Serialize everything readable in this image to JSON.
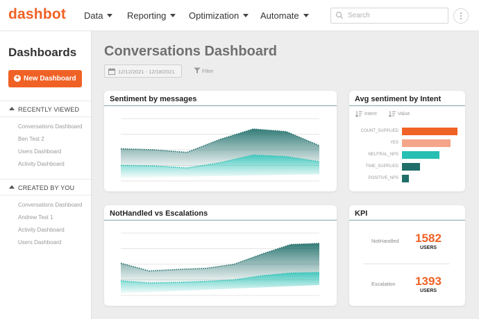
{
  "app": {
    "logo": "dashbot"
  },
  "nav": {
    "items": [
      {
        "label": "Data"
      },
      {
        "label": "Reporting"
      },
      {
        "label": "Optimization"
      },
      {
        "label": "Automate"
      }
    ]
  },
  "search": {
    "placeholder": "Search",
    "value": ""
  },
  "sidebar": {
    "title": "Dashboards",
    "new_button": "New Dashboard",
    "recent": {
      "label": "RECENTLY VIEWED",
      "items": [
        "Conversations Dashboard",
        "Ben Test 2",
        "Users Dashboard",
        "Activity Dashboard"
      ]
    },
    "created": {
      "label": "CREATED BY YOU",
      "items": [
        "Conversations Dashboard",
        "Andrew Test 1",
        "Activity Dashboard",
        "Users Dashboard"
      ]
    }
  },
  "main": {
    "title": "Conversations Dashboard",
    "date_range": "12/12/2021 - 12/18/2021",
    "filter_label": "Filter"
  },
  "cards": {
    "sentiment": {
      "title": "Sentiment by messages"
    },
    "intent": {
      "title": "Avg sentiment by Intent",
      "sort_intent": "Intent",
      "sort_value": "Value"
    },
    "nothandled": {
      "title": "NotHandled vs Escalations"
    },
    "kpi": {
      "title": "KPI",
      "rows": [
        {
          "label": "NotHandled",
          "value": "1582",
          "unit": "USERS"
        },
        {
          "label": "Escalation",
          "value": "1393",
          "unit": "USERS"
        }
      ]
    }
  },
  "colors": {
    "accent": "#f06125",
    "teal_dark": "#1f6e6a",
    "teal_light": "#27bfb3",
    "salmon": "#f5a58a"
  },
  "chart_data": [
    {
      "type": "area",
      "title": "Sentiment by messages",
      "x": [
        0,
        1,
        2,
        3,
        4,
        5,
        6
      ],
      "series": [
        {
          "values": [
            0.62,
            0.6,
            0.55,
            0.8,
            1.0,
            0.95,
            0.68
          ]
        },
        {
          "values": [
            0.3,
            0.29,
            0.25,
            0.35,
            0.5,
            0.47,
            0.37
          ]
        }
      ],
      "ylim": [
        0,
        1.2
      ],
      "grid": true
    },
    {
      "type": "bar",
      "title": "Avg sentiment by Intent",
      "orientation": "horizontal",
      "categories": [
        "COUNT_SUPPLIED",
        "YES",
        "NEUTRAL_NPS",
        "TIME_SUPPLIED",
        "POSITIVE_NPS"
      ],
      "values": [
        1.0,
        0.87,
        0.67,
        0.32,
        0.13
      ],
      "colors": [
        "#f06125",
        "#f5a58a",
        "#27bfb3",
        "#1f6e6a",
        "#1f6e6a"
      ]
    },
    {
      "type": "area",
      "title": "NotHandled vs Escalations",
      "x": [
        0,
        1,
        2,
        3,
        4,
        5,
        6,
        7
      ],
      "series": [
        {
          "values": [
            0.62,
            0.47,
            0.5,
            0.52,
            0.6,
            0.8,
            0.98,
            1.0
          ]
        },
        {
          "values": [
            0.28,
            0.24,
            0.25,
            0.27,
            0.3,
            0.38,
            0.43,
            0.44
          ]
        }
      ],
      "ylim": [
        0,
        1.2
      ],
      "grid": true
    }
  ]
}
